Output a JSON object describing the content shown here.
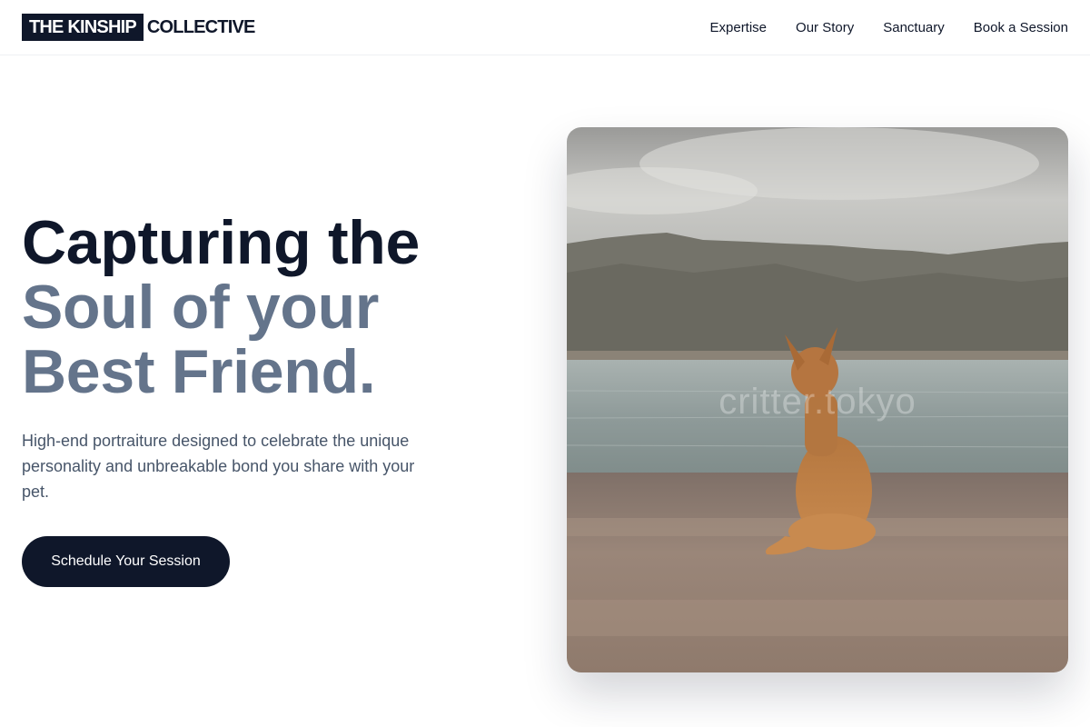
{
  "brand": {
    "boxed": "THE KINSHIP",
    "rest": "COLLECTIVE"
  },
  "nav": {
    "links": [
      "Expertise",
      "Our Story",
      "Sanctuary",
      "Book a Session"
    ]
  },
  "hero": {
    "headline_line1": "Capturing the",
    "headline_line2": "Soul of your",
    "headline_line3": "Best Friend.",
    "subtitle": "High-end portraiture designed to celebrate the unique personality and unbreakable bond you share with your pet.",
    "cta_label": "Schedule Your Session"
  },
  "image": {
    "watermark": "critter.tokyo",
    "subject": "dog sitting on a lakeshore facing mountains"
  },
  "colors": {
    "primary": "#0f172a",
    "muted_headline": "#64748b",
    "body_text": "#475569",
    "background": "#ffffff"
  }
}
